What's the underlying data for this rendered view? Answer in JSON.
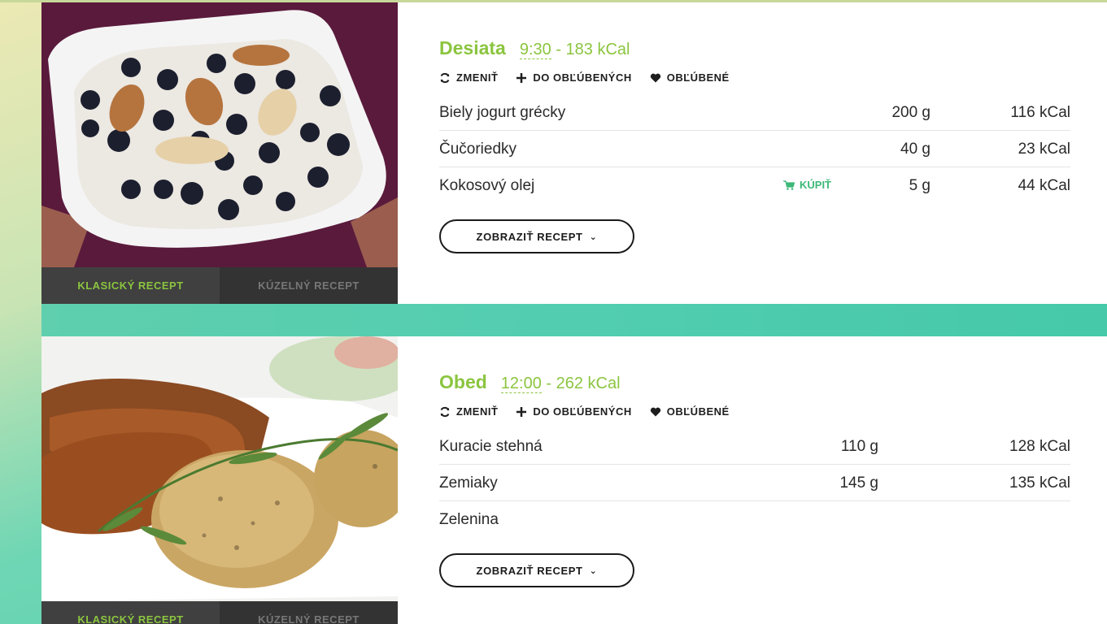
{
  "meals": [
    {
      "name": "Desiata",
      "time": "9:30",
      "kcal_text": "- 183 kCal",
      "actions": {
        "change": "ZMENIŤ",
        "add_favorite": "DO OBĽÚBENÝCH",
        "favorites": "OBĽÚBENÉ"
      },
      "ingredients": [
        {
          "name": "Biely jogurt grécky",
          "amount": "200 g",
          "kcal": "116 kCal",
          "buy": ""
        },
        {
          "name": "Čučoriedky",
          "amount": "40 g",
          "kcal": "23 kCal",
          "buy": ""
        },
        {
          "name": "Kokosový olej",
          "amount": "5 g",
          "kcal": "44 kCal",
          "buy": "KÚPIŤ"
        }
      ],
      "recipe_button": "ZOBRAZIŤ RECEPT",
      "tabs": {
        "classic": "KLASICKÝ RECEPT",
        "magic": "KÚZELNÝ RECEPT"
      },
      "image_icon": "yogurt-blueberries-photo"
    },
    {
      "name": "Obed",
      "time": "12:00",
      "kcal_text": "- 262 kCal",
      "actions": {
        "change": "ZMENIŤ",
        "add_favorite": "DO OBĽÚBENÝCH",
        "favorites": "OBĽÚBENÉ"
      },
      "ingredients": [
        {
          "name": "Kuracie stehná",
          "amount": "110 g",
          "kcal": "128 kCal",
          "buy": ""
        },
        {
          "name": "Zemiaky",
          "amount": "145 g",
          "kcal": "135 kCal",
          "buy": ""
        },
        {
          "name": "Zelenina",
          "amount": "",
          "kcal": "",
          "buy": ""
        }
      ],
      "recipe_button": "ZOBRAZIŤ RECEPT",
      "tabs": {
        "classic": "KLASICKÝ RECEPT",
        "magic": "KÚZELNÝ RECEPT"
      },
      "image_icon": "chicken-potatoes-photo"
    }
  ],
  "colors": {
    "accent_green": "#8bc53f",
    "buy_green": "#3cb878",
    "tab_bar": "#3a3a3a"
  }
}
